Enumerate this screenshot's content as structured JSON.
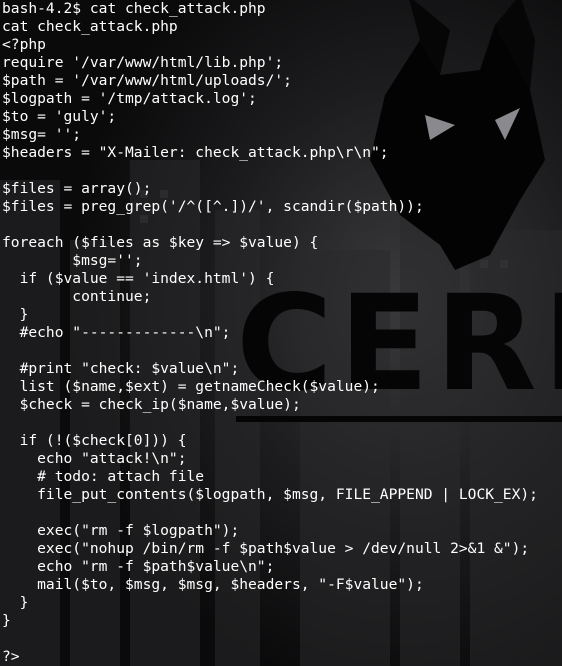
{
  "terminal": {
    "prompt": "bash-4.2$ ",
    "command": "cat check_attack.php",
    "echoed_command": "cat check_attack.php",
    "file_lines": [
      "<?php",
      "require '/var/www/html/lib.php';",
      "$path = '/var/www/html/uploads/';",
      "$logpath = '/tmp/attack.log';",
      "$to = 'guly';",
      "$msg= '';",
      "$headers = \"X-Mailer: check_attack.php\\r\\n\";",
      "",
      "$files = array();",
      "$files = preg_grep('/^([^.])/', scandir($path));",
      "",
      "foreach ($files as $key => $value) {",
      "        $msg='';",
      "  if ($value == 'index.html') {",
      "        continue;",
      "  }",
      "  #echo \"-------------\\n\";",
      "",
      "  #print \"check: $value\\n\";",
      "  list ($name,$ext) = getnameCheck($value);",
      "  $check = check_ip($name,$value);",
      "",
      "  if (!($check[0])) {",
      "    echo \"attack!\\n\";",
      "    # todo: attach file",
      "    file_put_contents($logpath, $msg, FILE_APPEND | LOCK_EX);",
      "",
      "    exec(\"rm -f $logpath\");",
      "    exec(\"nohup /bin/rm -f $path$value > /dev/null 2>&1 &\");",
      "    echo \"rm -f $path$value\\n\";",
      "    mail($to, $msg, $msg, $headers, \"-F$value\");",
      "  }",
      "}",
      "",
      "?>"
    ]
  },
  "wallpaper": {
    "wordmark": "CERBE",
    "logo": "cerberus-wolf-head-logo",
    "colors": {
      "background": "#0b0b0c",
      "text": "#ffffff",
      "wordmark": "#050505"
    }
  }
}
